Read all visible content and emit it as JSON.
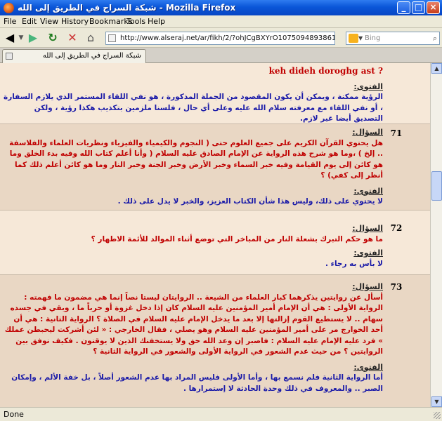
{
  "window": {
    "title": "شبكة السراج في الطريق إلى الله - Mozilla Firefox",
    "min": "_",
    "max": "□",
    "close": "×"
  },
  "menu": [
    "File",
    "Edit",
    "View",
    "History",
    "Bookmarks",
    "Tools",
    "Help"
  ],
  "nav": {
    "url": "http://www.alseraj.net/ar/fikh/2/?ohJCgBXYrO1075094893861&908&3",
    "search_placeholder": "Bing"
  },
  "tab": {
    "title": "شبكة السراج في الطريق إلى الله"
  },
  "status": "Done",
  "labels": {
    "question": "السؤال:",
    "answer": "الفتوى:"
  },
  "entries": [
    {
      "q_top": "keh dideh doroghg ast ?",
      "answer": "الرؤية ممكنة ، ويمكن أن يكون المقصود من الجملة المذكورة ، هو نفي اللقاء المستمر الذي يلازم السفارة ، أو نفي اللقاء مع معرفته سلام الله عليه وعلى أي حال ، فلسنا ملزمين بتكذيب هكذا رؤية ، ولكن التصديق أيضا غير لازم."
    },
    {
      "number": "71",
      "question": "هل يحتوي القرآن الكريم على جميع العلوم حتى ( النجوم والكيمياء والفيزياء ونظريات العلماء والفلاسفة .. إلخ ) ،وما هو شرح هذه الرواية عن الإمام الصادق عليه السلام ( وأنا أعلم كتاب الله وفيه بدء الخلق وما هو كائن إلى يوم القيامة وفيه خبر السماء وخبر الأرض وخبر الجنة وخبر النار وما هو كائن أعلم ذلك كما أنظر إلى كفي) ؟",
      "answer": "لا يحتوي على ذلك، وليس هذا شأن الكتاب العزيز، والخبر لا يدل على ذلك ."
    },
    {
      "number": "72",
      "question": "ما هو حكم التبرك بشعلة النار من المباخر التي توضع أثناء الموالد للأئمة الاطهار ؟",
      "answer": "لا بأس به رجاء ."
    },
    {
      "number": "73",
      "question": "أسأل عن روايتين يذكرهما كبار العلماء من الشيعة .. الروايتان ليستا نصاً إنما هي مضمون ما فهمته : الرواية الأولى : هي أن الإمام أمير المؤمنين عليه السلام كان إذا دخل غزوة أو حرباً ما ، وبقي في جسده سهام .. لا يستطيع القوم إزالتها إلا بعد ما يدخل الإمام عليه السلام في الصلاة ؟ الرواية الثانية : هي أن أحد الخوارج مر على أمير المؤمنين عليه السلام وهو يصلي ، فقال الخارجي : « لئن أشركت ليحبطن عملك » فرد عليه الإمام عليه السلام : فاصبر إن وعد الله حق ولا يستخفنك الذين لا يوقنون . فكيف نوفق بين الروايتين ؟ من حيث عدم الشعور في الرواية الأولى والشعور في الرواية الثانية ؟",
      "answer": "أما الرواية الثانية فلم نسمع بها ، وأما الأولى فليس المراد بها عدم الشعور أصلاً ، بل خفة الألم ، وإمكان الصبر .. والمعروف في ذلك وحدة الحادثة لا إستمرارها ."
    }
  ]
}
